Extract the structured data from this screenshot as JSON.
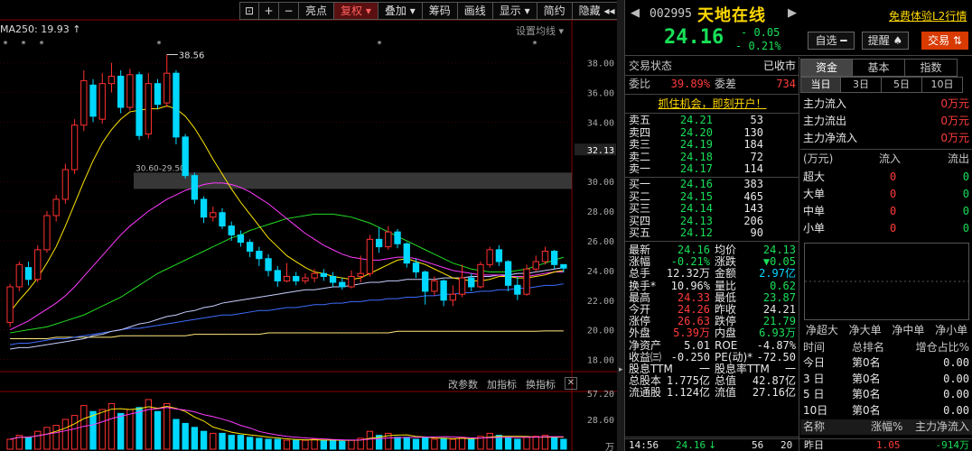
{
  "toolbar": {
    "items": [
      "亮点",
      "复权",
      "叠加",
      "筹码",
      "画线",
      "显示",
      "简约",
      "隐藏"
    ],
    "icons": [
      "lock-icon",
      "plus-icon",
      "minus-icon",
      "arrows-icon"
    ]
  },
  "chart": {
    "ma_label": "MA250: 19.93 ↑",
    "settings_label": "设置均线 ▾",
    "high_marker": "38.56",
    "zone_label": "30.60-29.50",
    "price_axis": [
      "38.00",
      "36.00",
      "34.00",
      "32.13",
      "30.00",
      "28.00",
      "26.00",
      "24.00",
      "22.00",
      "20.00",
      "18.00"
    ],
    "volume_axis": [
      "57.20",
      "28.60",
      "万"
    ],
    "volume_toolbar": [
      "改参数",
      "加指标",
      "换指标"
    ]
  },
  "header": {
    "code": "002995",
    "name": "天地在线",
    "price": "24.16",
    "change": "- 0.05",
    "change_pct": "- 0.21%",
    "trial_link": "免费体验L2行情",
    "fav_button": "自选 ━",
    "alert_button": "提醒 ♠",
    "trade_button": "交易 ⇅"
  },
  "quote": {
    "status_label": "交易状态",
    "status_value": "已收市",
    "weibi_label": "委比",
    "weibi_value": "39.89%",
    "weicha_label": "委差",
    "weicha_value": "734",
    "promo": "抓住机会，即刻开户！",
    "asks": [
      {
        "label": "卖五",
        "price": "24.21",
        "qty": "53"
      },
      {
        "label": "卖四",
        "price": "24.20",
        "qty": "130"
      },
      {
        "label": "卖三",
        "price": "24.19",
        "qty": "184"
      },
      {
        "label": "卖二",
        "price": "24.18",
        "qty": "72"
      },
      {
        "label": "卖一",
        "price": "24.17",
        "qty": "114"
      }
    ],
    "bids": [
      {
        "label": "买一",
        "price": "24.16",
        "qty": "383"
      },
      {
        "label": "买二",
        "price": "24.15",
        "qty": "465"
      },
      {
        "label": "买三",
        "price": "24.14",
        "qty": "143"
      },
      {
        "label": "买四",
        "price": "24.13",
        "qty": "206"
      },
      {
        "label": "买五",
        "price": "24.12",
        "qty": "90"
      }
    ],
    "stats": [
      {
        "l1": "最新",
        "v1": "24.16",
        "c1": "green",
        "l2": "均价",
        "v2": "24.13",
        "c2": "green"
      },
      {
        "l1": "涨幅",
        "v1": "-0.21%",
        "c1": "green",
        "l2": "涨跌",
        "v2": "▼0.05",
        "c2": "green"
      },
      {
        "l1": "总手",
        "v1": "12.32万",
        "c1": "white",
        "l2": "金额",
        "v2": "2.97亿",
        "c2": "cyan"
      },
      {
        "l1": "换手*",
        "v1": "10.96%",
        "c1": "white",
        "l2": "量比",
        "v2": "0.62",
        "c2": "green"
      },
      {
        "l1": "最高",
        "v1": "24.33",
        "c1": "red",
        "l2": "最低",
        "v2": "23.87",
        "c2": "green"
      },
      {
        "l1": "今开",
        "v1": "24.26",
        "c1": "red",
        "l2": "昨收",
        "v2": "24.21",
        "c2": "white"
      },
      {
        "l1": "涨停",
        "v1": "26.63",
        "c1": "red",
        "l2": "跌停",
        "v2": "21.79",
        "c2": "green"
      },
      {
        "l1": "外盘",
        "v1": "5.39万",
        "c1": "red",
        "l2": "内盘",
        "v2": "6.93万",
        "c2": "green"
      },
      {
        "l1": "净资产",
        "v1": "5.01",
        "c1": "white",
        "l2": "ROE",
        "v2": "-4.87%",
        "c2": "white"
      },
      {
        "l1": "收益㈢",
        "v1": "-0.250",
        "c1": "white",
        "l2": "PE(动)*",
        "v2": "-72.50",
        "c2": "white"
      },
      {
        "l1": "股息TTM",
        "v1": "一",
        "c1": "white",
        "l2": "股息率TTM",
        "v2": "一",
        "c2": "white"
      },
      {
        "l1": "总股本",
        "v1": "1.775亿",
        "c1": "white",
        "l2": "总值",
        "v2": "42.87亿",
        "c2": "white"
      },
      {
        "l1": "流通股",
        "v1": "1.124亿",
        "c1": "white",
        "l2": "流值",
        "v2": "27.16亿",
        "c2": "white"
      }
    ],
    "tick": {
      "time": "14:56",
      "price": "24.16",
      "arrow": "↓",
      "vol": "56",
      "num": "20"
    }
  },
  "fund": {
    "tabs": [
      "资金",
      "基本",
      "指数"
    ],
    "periods": [
      "当日",
      "3日",
      "5日",
      "10日"
    ],
    "flows": [
      {
        "label": "主力流入",
        "value": "0万元"
      },
      {
        "label": "主力流出",
        "value": "0万元"
      },
      {
        "label": "主力净流入",
        "value": "0万元"
      }
    ],
    "table_header": {
      "unit": "(万元)",
      "in": "流入",
      "out": "流出"
    },
    "table": [
      {
        "label": "超大",
        "in": "0",
        "out": "0"
      },
      {
        "label": "大单",
        "in": "0",
        "out": "0"
      },
      {
        "label": "中单",
        "in": "0",
        "out": "0"
      },
      {
        "label": "小单",
        "in": "0",
        "out": "0"
      }
    ],
    "bar_labels": [
      "净超大",
      "净大单",
      "净中单",
      "净小单"
    ],
    "rank_header": {
      "c1": "时间",
      "c2": "总排名",
      "c3": "增仓占比%"
    },
    "ranks": [
      {
        "c1": "今日",
        "c2": "第0名",
        "c3": "0.00"
      },
      {
        "c1": "3 日",
        "c2": "第0名",
        "c3": "0.00"
      },
      {
        "c1": "5 日",
        "c2": "第0名",
        "c3": "0.00"
      },
      {
        "c1": "10日",
        "c2": "第0名",
        "c3": "0.00"
      }
    ],
    "bottom_header": {
      "c1": "名称",
      "c2": "涨幅%",
      "c3": "主力净流入"
    },
    "bottom_row": {
      "c1": "昨日",
      "c2": "1.05",
      "c3": "-914万"
    }
  },
  "chart_data": {
    "type": "candlestick",
    "ylim": [
      17.0,
      39.5
    ],
    "candles": [
      [
        20.5,
        22.9,
        20.2,
        23.1
      ],
      [
        22.9,
        24.4,
        22.6,
        24.6
      ],
      [
        24.2,
        23.4,
        23.0,
        24.6
      ],
      [
        23.4,
        25.4,
        23.2,
        25.7
      ],
      [
        25.4,
        27.7,
        25.2,
        28.0
      ],
      [
        27.7,
        28.8,
        27.3,
        29.1
      ],
      [
        28.8,
        30.8,
        28.5,
        31.2
      ],
      [
        30.8,
        33.8,
        30.5,
        34.2
      ],
      [
        33.8,
        36.8,
        33.4,
        37.5
      ],
      [
        36.5,
        34.4,
        34.0,
        36.9
      ],
      [
        34.2,
        36.6,
        33.9,
        37.3
      ],
      [
        36.6,
        37.1,
        36.0,
        38.0
      ],
      [
        37.1,
        35.0,
        34.6,
        37.5
      ],
      [
        35.0,
        37.2,
        34.8,
        37.6
      ],
      [
        37.2,
        33.1,
        32.8,
        37.4
      ],
      [
        33.2,
        36.6,
        32.9,
        37.3
      ],
      [
        36.6,
        35.2,
        34.9,
        36.9
      ],
      [
        35.3,
        37.3,
        35.0,
        38.56
      ],
      [
        37.3,
        33.0,
        32.5,
        37.5
      ],
      [
        33.0,
        30.4,
        30.2,
        33.2
      ],
      [
        30.4,
        28.8,
        28.5,
        30.6
      ],
      [
        28.8,
        27.6,
        27.2,
        29.0
      ],
      [
        27.6,
        27.9,
        27.3,
        28.3
      ],
      [
        27.9,
        27.0,
        26.8,
        28.2
      ],
      [
        27.0,
        26.4,
        26.0,
        27.3
      ],
      [
        26.4,
        25.9,
        25.6,
        26.7
      ],
      [
        25.9,
        25.3,
        24.9,
        26.1
      ],
      [
        25.3,
        24.8,
        24.3,
        25.6
      ],
      [
        24.8,
        24.0,
        23.6,
        25.1
      ],
      [
        24.0,
        23.3,
        22.9,
        24.3
      ],
      [
        23.3,
        23.6,
        23.2,
        24.5
      ],
      [
        23.6,
        23.3,
        23.0,
        23.9
      ],
      [
        23.3,
        23.5,
        23.1,
        23.8
      ],
      [
        23.5,
        23.8,
        23.2,
        24.1
      ],
      [
        23.8,
        23.6,
        23.3,
        24.1
      ],
      [
        23.6,
        23.2,
        22.9,
        23.9
      ],
      [
        23.2,
        22.9,
        22.7,
        23.5
      ],
      [
        22.9,
        23.6,
        22.8,
        24.0
      ],
      [
        23.6,
        23.8,
        23.2,
        25.0
      ],
      [
        23.8,
        26.1,
        23.6,
        26.4
      ],
      [
        26.1,
        25.6,
        25.2,
        26.9
      ],
      [
        25.6,
        26.6,
        25.4,
        27.0
      ],
      [
        26.6,
        25.8,
        25.5,
        26.8
      ],
      [
        25.8,
        24.5,
        24.2,
        25.9
      ],
      [
        24.5,
        23.9,
        23.5,
        24.8
      ],
      [
        23.9,
        22.6,
        21.7,
        24.0
      ],
      [
        22.6,
        23.3,
        22.3,
        23.6
      ],
      [
        23.3,
        22.0,
        21.6,
        23.4
      ],
      [
        22.0,
        22.4,
        21.6,
        23.0
      ],
      [
        22.4,
        23.5,
        22.2,
        24.4
      ],
      [
        23.5,
        22.9,
        22.6,
        23.8
      ],
      [
        22.9,
        24.4,
        22.8,
        24.6
      ],
      [
        24.4,
        25.4,
        24.2,
        25.6
      ],
      [
        25.4,
        24.6,
        24.3,
        25.7
      ],
      [
        24.6,
        23.0,
        22.6,
        24.7
      ],
      [
        23.0,
        22.4,
        22.0,
        23.6
      ],
      [
        22.4,
        24.1,
        22.3,
        24.4
      ],
      [
        24.1,
        24.6,
        23.9,
        25.0
      ],
      [
        24.6,
        25.3,
        24.4,
        25.6
      ],
      [
        25.3,
        24.4,
        24.1,
        25.4
      ],
      [
        24.4,
        24.16,
        23.87,
        24.33
      ]
    ],
    "ma_yellow": [
      21.2,
      22.0,
      22.7,
      23.5,
      24.5,
      25.6,
      27.0,
      28.5,
      30.0,
      31.4,
      32.6,
      33.5,
      34.2,
      34.7,
      34.8,
      34.9,
      34.9,
      35.1,
      34.9,
      34.4,
      33.6,
      32.6,
      31.5,
      30.5,
      29.5,
      28.6,
      27.8,
      27.0,
      26.2,
      25.6,
      25.0,
      24.6,
      24.2,
      23.9,
      23.8,
      23.6,
      23.5,
      23.4,
      23.5,
      23.8,
      24.1,
      24.4,
      24.7,
      24.8,
      24.6,
      24.4,
      24.1,
      23.8,
      23.5,
      23.4,
      23.3,
      23.3,
      23.4,
      23.6,
      23.6,
      23.5,
      23.5,
      23.6,
      23.7,
      23.9,
      24.0
    ],
    "ma_magenta": [
      20.0,
      20.3,
      20.6,
      21.0,
      21.4,
      21.8,
      22.3,
      22.9,
      23.6,
      24.3,
      25.0,
      25.7,
      26.4,
      27.0,
      27.5,
      28.0,
      28.4,
      28.8,
      29.1,
      29.4,
      29.6,
      29.8,
      29.9,
      29.9,
      29.8,
      29.6,
      29.3,
      28.9,
      28.5,
      28.0,
      27.5,
      27.0,
      26.5,
      26.1,
      25.7,
      25.4,
      25.1,
      24.9,
      24.8,
      24.7,
      24.7,
      24.8,
      24.9,
      24.9,
      24.8,
      24.6,
      24.4,
      24.2,
      24.0,
      23.9,
      23.8,
      23.7,
      23.7,
      23.7,
      23.6,
      23.6,
      23.6,
      23.7,
      23.8,
      23.9,
      23.9
    ],
    "ma_green": [
      19.8,
      19.9,
      20.0,
      20.1,
      20.2,
      20.4,
      20.6,
      20.8,
      21.0,
      21.3,
      21.6,
      21.9,
      22.2,
      22.6,
      23.0,
      23.4,
      23.8,
      24.1,
      24.4,
      24.7,
      25.0,
      25.3,
      25.6,
      25.9,
      26.2,
      26.4,
      26.7,
      26.9,
      27.1,
      27.3,
      27.5,
      27.6,
      27.7,
      27.8,
      27.8,
      27.8,
      27.7,
      27.6,
      27.4,
      27.2,
      26.9,
      26.6,
      26.3,
      26.0,
      25.7,
      25.4,
      25.1,
      24.8,
      24.5,
      24.3,
      24.1,
      24.0,
      23.9,
      23.9,
      23.9,
      24.0,
      24.1,
      24.3,
      24.5,
      24.7,
      24.9
    ],
    "ma_lightblue": [
      18.7,
      18.8,
      18.8,
      18.9,
      19.0,
      19.1,
      19.2,
      19.3,
      19.4,
      19.6,
      19.7,
      19.9,
      20.0,
      20.2,
      20.4,
      20.5,
      20.7,
      20.9,
      21.0,
      21.2,
      21.3,
      21.5,
      21.6,
      21.8,
      21.9,
      22.0,
      22.1,
      22.2,
      22.3,
      22.4,
      22.5,
      22.6,
      22.7,
      22.7,
      22.8,
      22.9,
      22.9,
      23.0,
      23.1,
      23.2,
      23.2,
      23.3,
      23.3,
      23.4,
      23.4,
      23.4,
      23.4,
      23.5,
      23.5,
      23.5,
      23.6,
      23.6,
      23.6,
      23.7,
      23.7,
      23.8,
      23.8,
      23.9,
      24.0,
      24.1,
      24.2
    ],
    "ma_blue": [
      19.0,
      19.1,
      19.1,
      19.2,
      19.3,
      19.4,
      19.4,
      19.5,
      19.6,
      19.7,
      19.8,
      19.9,
      20.0,
      20.1,
      20.1,
      20.2,
      20.3,
      20.4,
      20.5,
      20.6,
      20.7,
      20.8,
      20.9,
      21.0,
      21.0,
      21.1,
      21.2,
      21.3,
      21.3,
      21.4,
      21.5,
      21.5,
      21.6,
      21.7,
      21.7,
      21.8,
      21.8,
      21.9,
      21.9,
      22.0,
      22.0,
      22.1,
      22.1,
      22.2,
      22.2,
      22.3,
      22.3,
      22.4,
      22.4,
      22.5,
      22.5,
      22.6,
      22.6,
      22.7,
      22.7,
      22.8,
      22.8,
      22.9,
      23.0,
      23.0,
      23.1
    ],
    "ma250": [
      19.4,
      19.4,
      19.4,
      19.4,
      19.4,
      19.5,
      19.5,
      19.5,
      19.5,
      19.5,
      19.5,
      19.5,
      19.6,
      19.6,
      19.6,
      19.6,
      19.6,
      19.6,
      19.6,
      19.6,
      19.7,
      19.7,
      19.7,
      19.7,
      19.7,
      19.7,
      19.7,
      19.7,
      19.8,
      19.8,
      19.8,
      19.8,
      19.8,
      19.8,
      19.8,
      19.8,
      19.8,
      19.8,
      19.8,
      19.8,
      19.8,
      19.8,
      19.9,
      19.9,
      19.9,
      19.9,
      19.9,
      19.9,
      19.9,
      19.9,
      19.9,
      19.9,
      19.9,
      19.9,
      19.9,
      19.9,
      19.9,
      19.9,
      19.93,
      19.93,
      19.93
    ],
    "volume": [
      10,
      14,
      12,
      18,
      22,
      24,
      30,
      34,
      44,
      38,
      40,
      46,
      36,
      40,
      42,
      50,
      38,
      46,
      30,
      26,
      22,
      18,
      16,
      16,
      14,
      14,
      12,
      11,
      10,
      10,
      9,
      9,
      9,
      10,
      9,
      9,
      8,
      9,
      11,
      18,
      14,
      16,
      12,
      12,
      10,
      12,
      10,
      11,
      10,
      12,
      10,
      13,
      16,
      14,
      12,
      10,
      12,
      13,
      14,
      12,
      10
    ],
    "volume_ylim": [
      0,
      60
    ]
  }
}
